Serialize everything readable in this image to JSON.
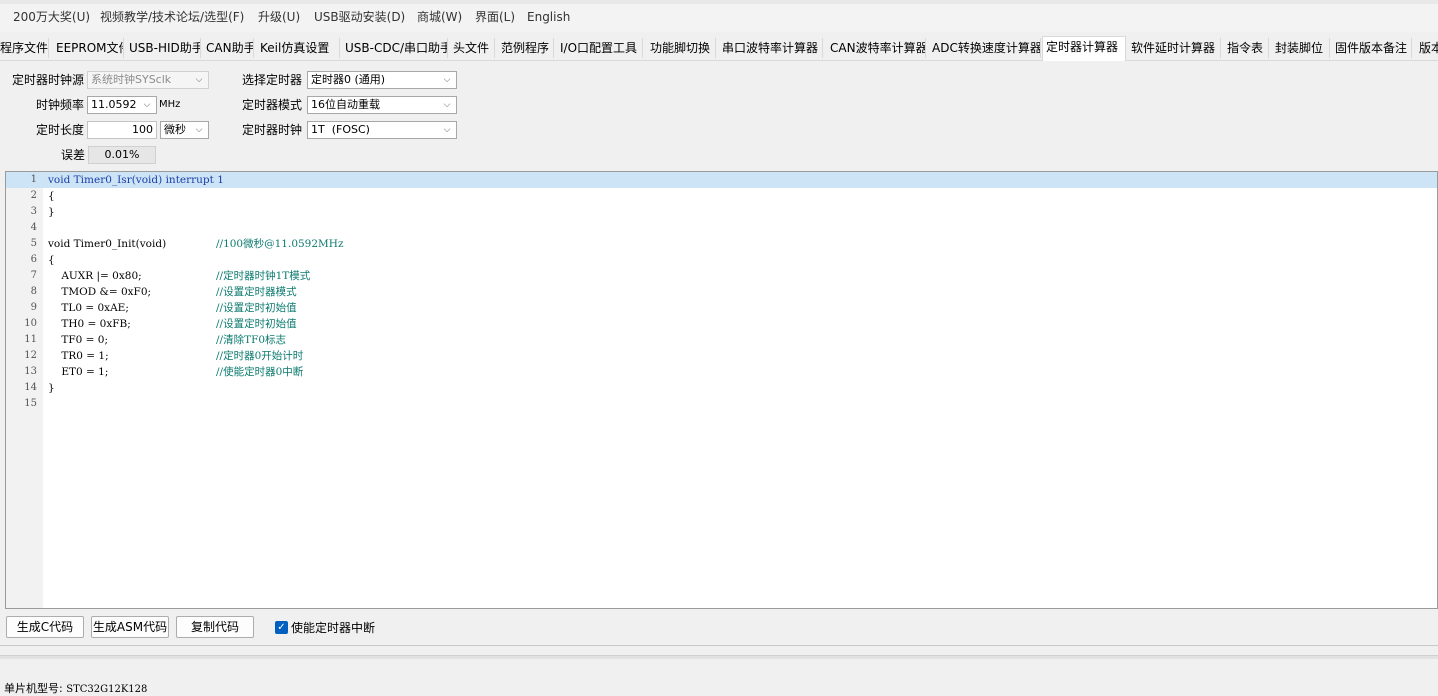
{
  "menu": [
    "200万大奖(U)",
    "视频教学/技术论坛/选型(F)",
    "升级(U)",
    "USB驱动安装(D)",
    "商城(W)",
    "界面(L)",
    "English"
  ],
  "tabs": [
    "程序文件",
    "EEPROM文件",
    "USB-HID助手",
    "CAN助手",
    "Keil仿真设置",
    "USB-CDC/串口助手",
    "头文件",
    "范例程序",
    "I/O口配置工具",
    "功能脚切换",
    "串口波特率计算器",
    "CAN波特率计算器",
    "ADC转换速度计算器",
    "定时器计算器",
    "软件延时计算器",
    "指令表",
    "封装脚位",
    "固件版本备注",
    "版本"
  ],
  "active_tab": "定时器计算器",
  "form": {
    "clock_source_label": "定时器时钟源",
    "clock_source_value": "系统时钟SYSclk",
    "freq_label": "时钟频率",
    "freq_value": "11.0592",
    "freq_unit": "MHz",
    "length_label": "定时长度",
    "length_value": "100",
    "length_unit": "微秒",
    "error_label": "误差",
    "error_value": "0.01%",
    "timer_select_label": "选择定时器",
    "timer_select_value": "定时器0 (通用)",
    "timer_mode_label": "定时器模式",
    "timer_mode_value": "16位自动重载",
    "timer_clock_label": "定时器时钟",
    "timer_clock_value": "1T  (FOSC)"
  },
  "code_lines": [
    {
      "n": "1",
      "text": "void Timer0_Isr(void) interrupt 1",
      "comment": ""
    },
    {
      "n": "2",
      "text": "{",
      "comment": ""
    },
    {
      "n": "3",
      "text": "}",
      "comment": ""
    },
    {
      "n": "4",
      "text": "",
      "comment": ""
    },
    {
      "n": "5",
      "text": "void Timer0_Init(void)",
      "comment": "//100微秒@11.0592MHz"
    },
    {
      "n": "6",
      "text": "{",
      "comment": ""
    },
    {
      "n": "7",
      "text": "    AUXR |= 0x80;",
      "comment": "//定时器时钟1T模式"
    },
    {
      "n": "8",
      "text": "    TMOD &= 0xF0;",
      "comment": "//设置定时器模式"
    },
    {
      "n": "9",
      "text": "    TL0 = 0xAE;",
      "comment": "//设置定时初始值"
    },
    {
      "n": "10",
      "text": "    TH0 = 0xFB;",
      "comment": "//设置定时初始值"
    },
    {
      "n": "11",
      "text": "    TF0 = 0;",
      "comment": "//清除TF0标志"
    },
    {
      "n": "12",
      "text": "    TR0 = 1;",
      "comment": "//定时器0开始计时"
    },
    {
      "n": "13",
      "text": "    ET0 = 1;",
      "comment": "//使能定时器0中断"
    },
    {
      "n": "14",
      "text": "}",
      "comment": ""
    },
    {
      "n": "15",
      "text": "",
      "comment": ""
    }
  ],
  "buttons": {
    "gen_c": "生成C代码",
    "gen_asm": "生成ASM代码",
    "copy": "复制代码",
    "enable_irq_label": "使能定时器中断",
    "enable_irq_checked": true
  },
  "status": {
    "label": "单片机型号:",
    "value": "STC32G12K128"
  }
}
